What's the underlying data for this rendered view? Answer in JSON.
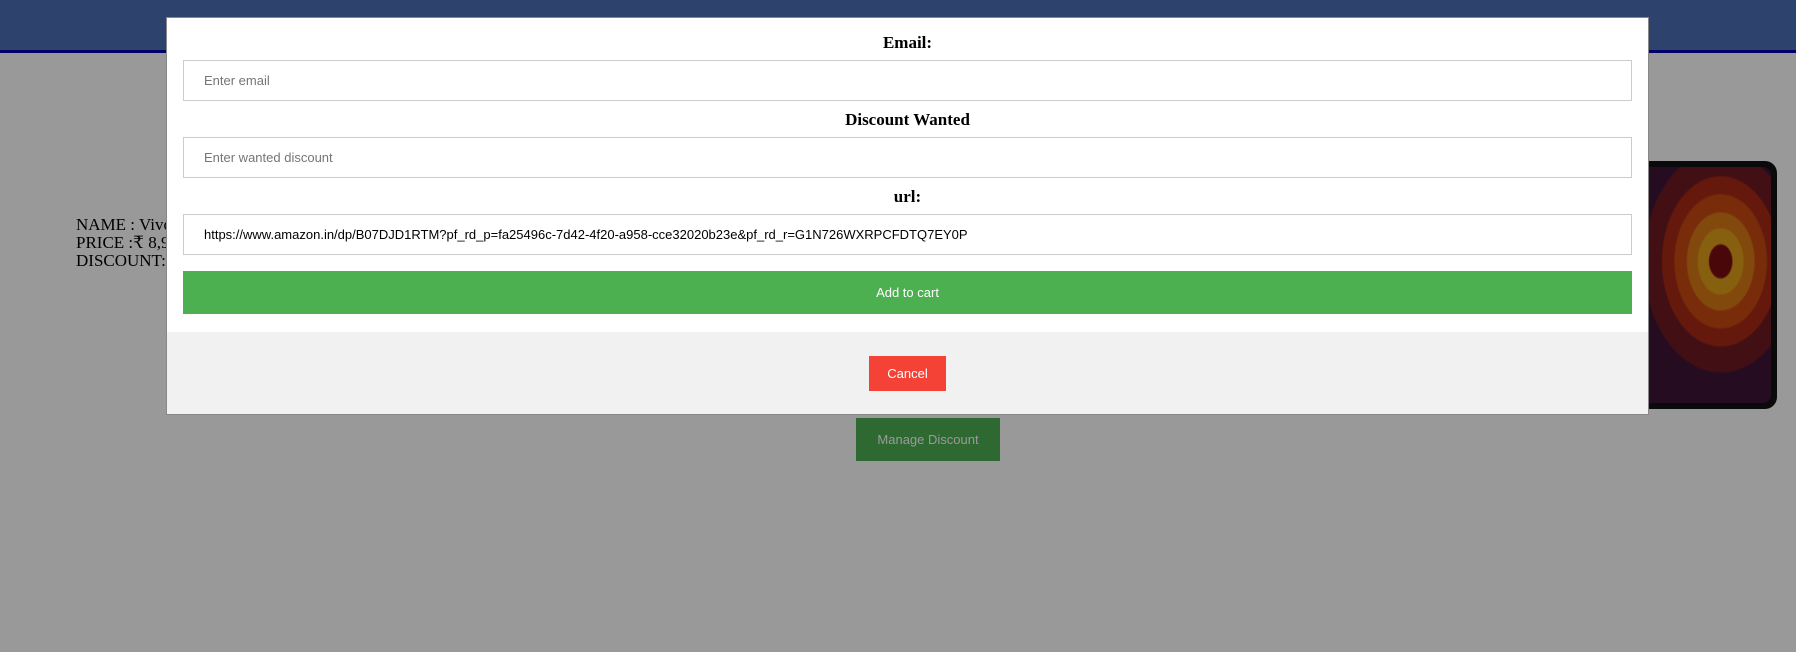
{
  "product": {
    "name_line": "NAME : Vivo",
    "price_line": "PRICE :₹ 8,9",
    "discount_line": "DISCOUNT:"
  },
  "actions": {
    "manage_discount_label": "Manage Discount"
  },
  "modal": {
    "email_label": "Email:",
    "email_placeholder": "Enter email",
    "discount_label": "Discount Wanted",
    "discount_placeholder": "Enter wanted discount",
    "url_label": "url:",
    "url_value": "https://www.amazon.in/dp/B07DJD1RTM?pf_rd_p=fa25496c-7d42-4f20-a958-cce32020b23e&pf_rd_r=G1N726WXRPCFDTQ7EY0P",
    "add_to_cart_label": "Add to cart",
    "cancel_label": "Cancel"
  },
  "colors": {
    "topbar": "#4c70b8",
    "primary_green": "#4caf50",
    "cancel_red": "#f44336",
    "overlay": "rgba(0,0,0,0.4)"
  }
}
